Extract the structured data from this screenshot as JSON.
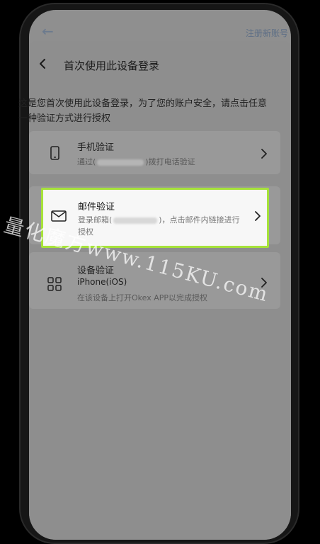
{
  "background_app": {
    "register_label": "注册新账号"
  },
  "header": {
    "title": "首次使用此设备登录"
  },
  "description": "这是您首次使用此设备登录，为了您的账户安全，请点击任意一种验证方式进行授权",
  "options": [
    {
      "label": "手机验证",
      "detail_prefix": "通过(",
      "detail_suffix": ")拨打电话验证",
      "icon": "phone-icon"
    },
    {
      "label": "邮件验证",
      "detail_prefix": "登录邮箱(",
      "detail_suffix": ")，点击邮件内链接进行",
      "detail_line2": "授权",
      "icon": "mail-icon",
      "highlighted": true
    },
    {
      "label": "设备验证",
      "device": "iPhone(iOS)",
      "detail": "在该设备上打开Okex APP以完成授权",
      "icon": "grid-icon"
    }
  ],
  "watermark": "量化魔方www.115KU.com",
  "colors": {
    "highlight_border": "#a6e23a",
    "overlay": "#8f8f8f"
  }
}
